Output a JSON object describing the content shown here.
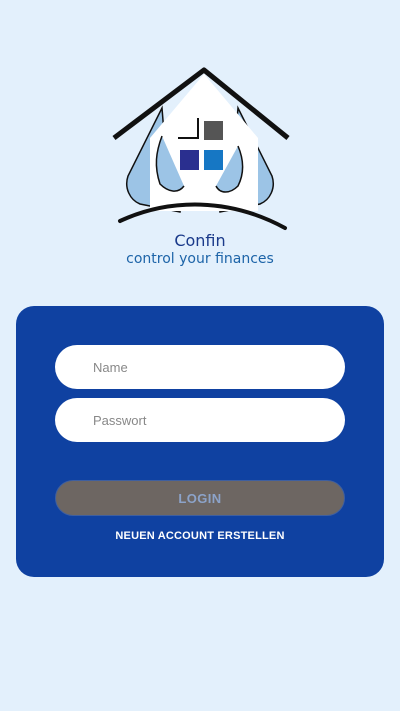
{
  "brand": {
    "name": "Confin",
    "tagline": "control your finances"
  },
  "login_form": {
    "name_placeholder": "Name",
    "password_placeholder": "Passwort",
    "login_label": "LOGIN",
    "create_account_label": "NEUEN ACCOUNT ERSTELLEN"
  },
  "colors": {
    "background": "#e3f0fc",
    "card": "#0f41a1",
    "login_button": "#6d6662",
    "brand_text": "#1a3a8a"
  },
  "icons": [
    "house-hands-logo"
  ]
}
